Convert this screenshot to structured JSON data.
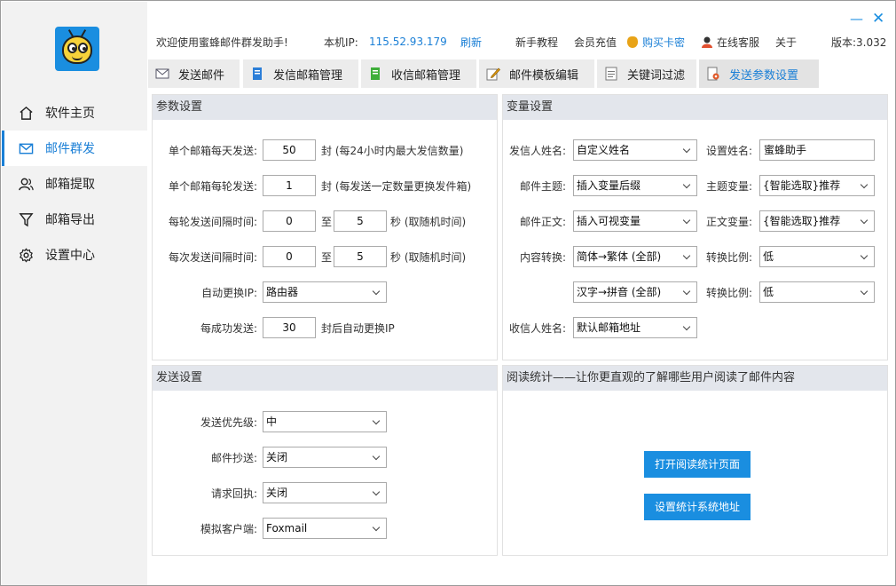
{
  "window": {
    "minimize_glyph": "—",
    "close_glyph": "✕"
  },
  "sidebar": {
    "items": [
      {
        "label": "软件主页",
        "icon": "home-icon"
      },
      {
        "label": "邮件群发",
        "icon": "mail-icon",
        "active": true
      },
      {
        "label": "邮箱提取",
        "icon": "users-icon"
      },
      {
        "label": "邮箱导出",
        "icon": "filter-icon"
      },
      {
        "label": "设置中心",
        "icon": "gear-icon"
      }
    ]
  },
  "topbar": {
    "welcome": "欢迎使用蜜蜂邮件群发助手!",
    "ip_label": "本机IP:",
    "ip": "115.52.93.179",
    "refresh": "刷新",
    "tutorial": "新手教程",
    "recharge": "会员充值",
    "buy_card": "购买卡密",
    "service": "在线客服",
    "about": "关于",
    "version": "版本:3.032"
  },
  "tabs": [
    {
      "label": "发送邮件"
    },
    {
      "label": "发信邮箱管理"
    },
    {
      "label": "收信邮箱管理"
    },
    {
      "label": "邮件模板编辑"
    },
    {
      "label": "关键词过滤"
    },
    {
      "label": "发送参数设置",
      "active": true
    }
  ],
  "params": {
    "title": "参数设置",
    "daily_label": "单个邮箱每天发送:",
    "daily_value": "50",
    "daily_hint": "封 (每24小时内最大发信数量)",
    "round_label": "单个邮箱每轮发送:",
    "round_value": "1",
    "round_hint": "封 (每发送一定数量更换发件箱)",
    "round_interval_label": "每轮发送间隔时间:",
    "round_interval_from": "0",
    "round_interval_to": "5",
    "to_word": "至",
    "interval_hint": "秒 (取随机时间)",
    "send_interval_label": "每次发送间隔时间:",
    "send_interval_from": "0",
    "send_interval_to": "5",
    "auto_ip_label": "自动更换IP:",
    "auto_ip_value": "路由器",
    "success_label": "每成功发送:",
    "success_value": "30",
    "success_hint": "封后自动更换IP"
  },
  "variables": {
    "title": "变量设置",
    "sender_name_label": "发信人姓名:",
    "sender_name_value": "自定义姓名",
    "set_name_label": "设置姓名:",
    "set_name_value": "蜜蜂助手",
    "subject_label": "邮件主题:",
    "subject_value": "插入变量后缀",
    "subject_var_label": "主题变量:",
    "subject_var_value": "{智能选取}推荐",
    "body_label": "邮件正文:",
    "body_value": "插入可视变量",
    "body_var_label": "正文变量:",
    "body_var_value": "{智能选取}推荐",
    "convert_label": "内容转换:",
    "convert_value": "简体→繁体 (全部)",
    "ratio_label": "转换比例:",
    "ratio_value": "低",
    "convert2_value": "汉字→拼音 (全部)",
    "ratio2_label": "转换比例:",
    "ratio2_value": "低",
    "recipient_label": "收信人姓名:",
    "recipient_value": "默认邮箱地址"
  },
  "send_settings": {
    "title": "发送设置",
    "priority_label": "发送优先级:",
    "priority_value": "中",
    "cc_label": "邮件抄送:",
    "cc_value": "关闭",
    "receipt_label": "请求回执:",
    "receipt_value": "关闭",
    "client_label": "模拟客户端:",
    "client_value": "Foxmail"
  },
  "read_stats": {
    "title": "阅读统计——让你更直观的了解哪些用户阅读了邮件内容",
    "open_button": "打开阅读统计页面",
    "set_button": "设置统计系统地址"
  },
  "colors": {
    "accent": "#1a7fd6",
    "button": "#1a8ee0",
    "panel_head": "#e3e6ec"
  }
}
